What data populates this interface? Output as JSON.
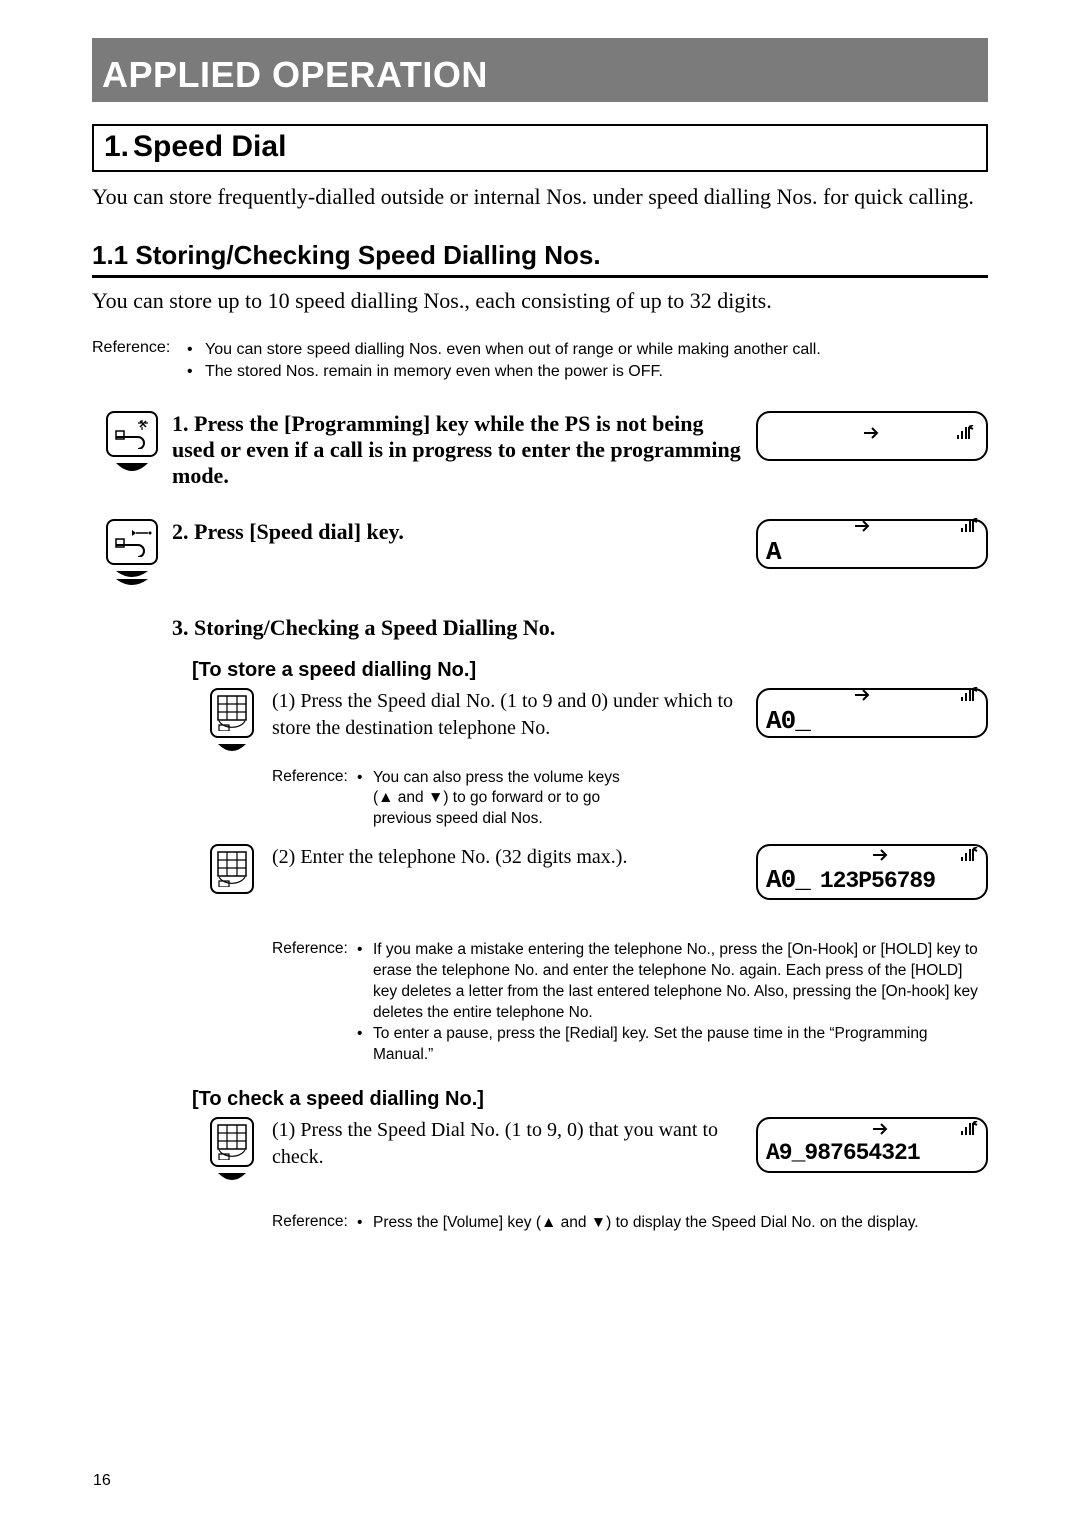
{
  "page_number": "16",
  "title_bar": "APPLIED OPERATION",
  "section": {
    "number": "1.",
    "title": "Speed Dial",
    "intro": "You can store frequently-dialled outside or internal Nos. under speed dialling Nos. for quick calling."
  },
  "subsection": {
    "title": "1.1 Storing/Checking Speed Dialling Nos.",
    "intro": "You can store up to 10 speed dialling Nos., each consisting of up to 32 digits."
  },
  "reference_top": {
    "label": "Reference:",
    "items": [
      "You can store speed dialling Nos. even when out of range or while making another call.",
      "The stored Nos. remain in memory even when the power is OFF."
    ]
  },
  "steps": {
    "s1": {
      "num": "1.",
      "text": "Press the [Programming] key while the PS is not being used or even if a call is in progress to enter the programming mode.",
      "lcd": ""
    },
    "s2": {
      "num": "2.",
      "text": "Press [Speed dial] key.",
      "lcd": "A"
    },
    "s3": {
      "num": "3.",
      "text": "Storing/Checking a Speed Dialling No."
    }
  },
  "store_block": {
    "heading": "[To store a speed dialling No.]",
    "sub1": {
      "num": "(1)",
      "text": "Press the Speed dial No. (1 to 9 and 0) under which to store the destination telephone No.",
      "lcd": "A0_"
    },
    "ref1": {
      "label": "Reference:",
      "items": [
        "You can also press the volume keys (▲ and ▼) to go forward or to go previous speed dial Nos."
      ]
    },
    "sub2": {
      "num": "(2)",
      "text": "Enter the telephone No. (32 digits max.).",
      "lcd_line1": "A0_",
      "lcd_line2": "123P56789"
    },
    "ref2": {
      "label": "Reference:",
      "items": [
        "If you make a mistake entering the telephone No., press the [On-Hook] or [HOLD] key to erase the telephone No. and enter the telephone No. again. Each press of the [HOLD] key deletes a letter from the last entered telephone No. Also, pressing the [On-hook] key deletes the entire telephone No.",
        "To enter a pause, press the [Redial] key. Set the pause time in the “Programming Manual.”"
      ]
    }
  },
  "check_block": {
    "heading": "[To check a speed dialling No.]",
    "sub1": {
      "num": "(1)",
      "text": "Press the Speed Dial No. (1 to 9, 0) that you want to check.",
      "lcd": "A9_987654321"
    },
    "ref1": {
      "label": "Reference:",
      "items": [
        "Press the [Volume] key (▲ and ▼) to display the Speed Dial No. on the display."
      ]
    }
  }
}
